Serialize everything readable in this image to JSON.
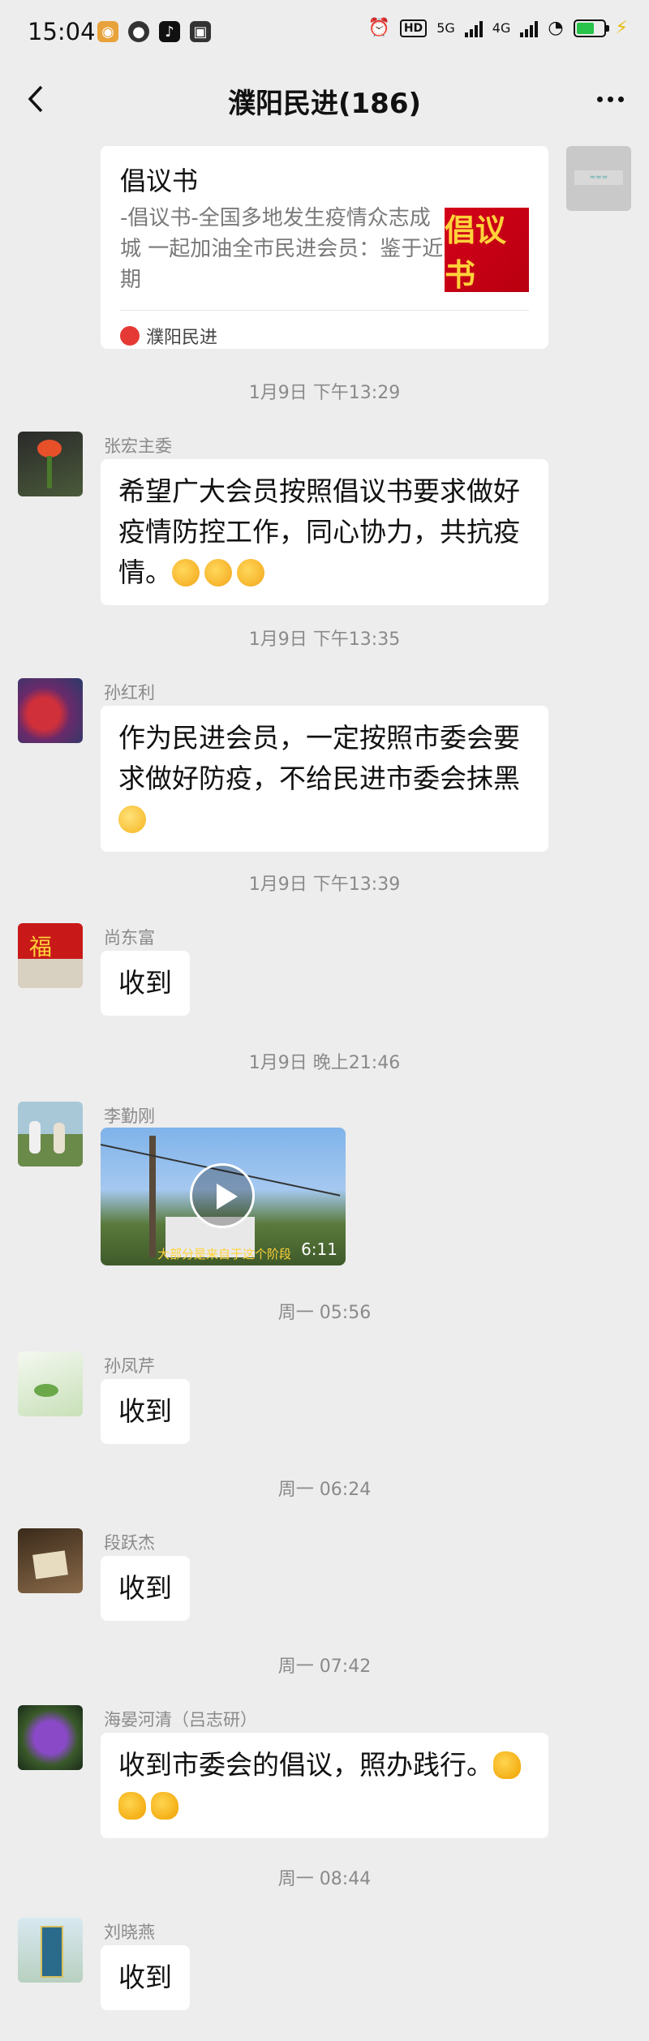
{
  "status_bar": {
    "time": "15:04",
    "network_5g": "5G",
    "network_4g": "4G",
    "hd": "HD"
  },
  "header": {
    "title": "濮阳民进(186)"
  },
  "card": {
    "title": "倡议书",
    "desc": "-倡议书-全国多地发生疫情众志成城 一起加油全市民进会员：鉴于近期",
    "thumb_text": "倡议书",
    "source": "濮阳民进"
  },
  "messages": [
    {
      "time": "1月9日  下午13:29",
      "sender": "张宏主委",
      "text": "希望广大会员按照倡议书要求做好疫情防控工作，同心协力，共抗疫情。"
    },
    {
      "time": "1月9日  下午13:35",
      "sender": "孙红利",
      "text": "作为民进会员，一定按照市委会要求做好防疫，不给民进市委会抹黑"
    },
    {
      "time": "1月9日  下午13:39",
      "sender": "尚东富",
      "text": "收到"
    },
    {
      "time": "1月9日  晚上21:46",
      "sender": "李勤刚",
      "video_duration": "6:11",
      "video_caption": "大部分是来自于这个阶段"
    },
    {
      "time": "周一  05:56",
      "sender": "孙凤芹",
      "text": "收到"
    },
    {
      "time": "周一  06:24",
      "sender": "段跃杰",
      "text": "收到"
    },
    {
      "time": "周一  07:42",
      "sender": "海晏河清（吕志研）",
      "text": "收到市委会的倡议，照办践行。"
    },
    {
      "time": "周一  08:44",
      "sender": "刘晓燕",
      "text": "收到"
    }
  ]
}
